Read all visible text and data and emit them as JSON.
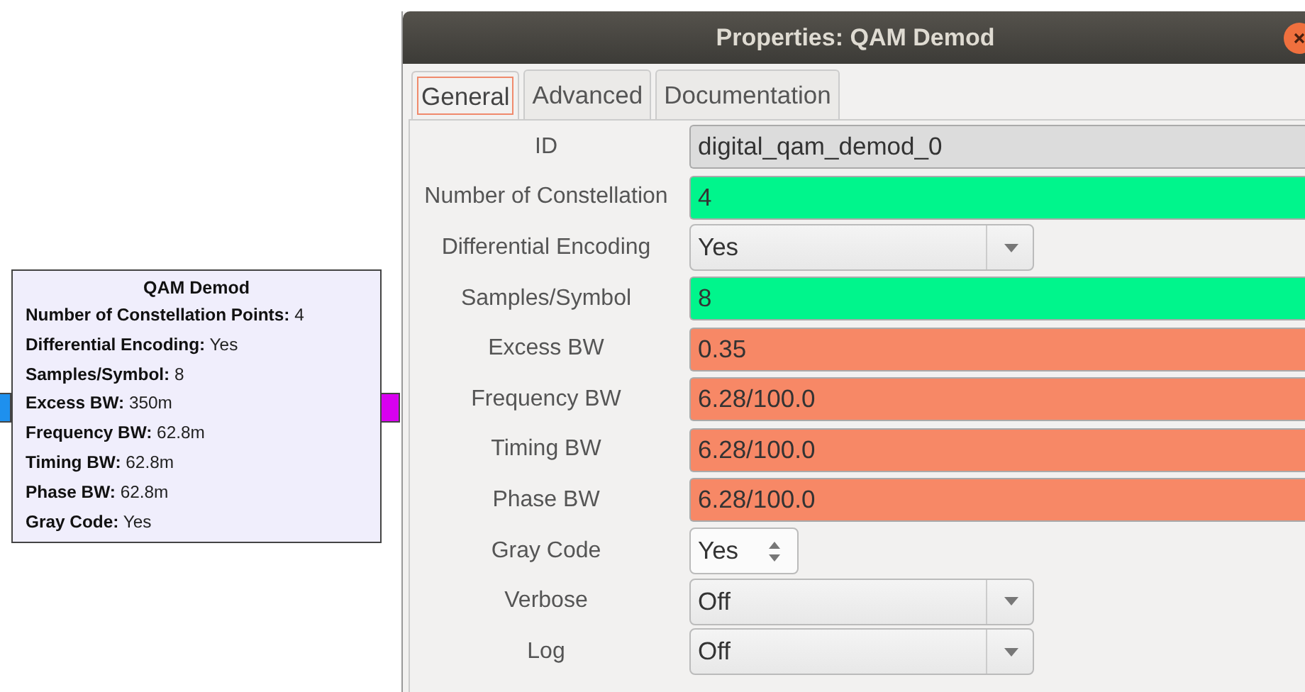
{
  "block": {
    "title": "QAM Demod",
    "params": [
      {
        "name": "Number of Constellation Points:",
        "value": "4"
      },
      {
        "name": "Differential Encoding:",
        "value": "Yes"
      },
      {
        "name": "Samples/Symbol:",
        "value": "8"
      },
      {
        "name": "Excess BW:",
        "value": "350m"
      },
      {
        "name": "Frequency BW:",
        "value": "62.8m"
      },
      {
        "name": "Timing BW:",
        "value": "62.8m"
      },
      {
        "name": "Phase BW:",
        "value": "62.8m"
      },
      {
        "name": "Gray Code:",
        "value": "Yes"
      }
    ]
  },
  "window": {
    "title": "Properties: QAM Demod"
  },
  "tabs": [
    {
      "label": "General",
      "selected": true
    },
    {
      "label": "Advanced",
      "selected": false
    },
    {
      "label": "Documentation",
      "selected": false
    }
  ],
  "fields": [
    {
      "label": "ID",
      "kind": "text",
      "value": "digital_qam_demod_0",
      "color": "#dcdcdc"
    },
    {
      "label": "Number of Constellation",
      "kind": "text",
      "value": "4",
      "color": "#00f58c"
    },
    {
      "label": "Differential Encoding",
      "kind": "combo",
      "value": "Yes"
    },
    {
      "label": "Samples/Symbol",
      "kind": "text",
      "value": "8",
      "color": "#00f58c"
    },
    {
      "label": "Excess BW",
      "kind": "text",
      "value": "0.35",
      "color": "#f78866"
    },
    {
      "label": "Frequency BW",
      "kind": "text",
      "value": "6.28/100.0",
      "color": "#f78866"
    },
    {
      "label": "Timing BW",
      "kind": "text",
      "value": "6.28/100.0",
      "color": "#f78866"
    },
    {
      "label": "Phase BW",
      "kind": "text",
      "value": "6.28/100.0",
      "color": "#f78866"
    },
    {
      "label": "Gray Code",
      "kind": "spin",
      "value": "Yes"
    },
    {
      "label": "Verbose",
      "kind": "combo",
      "value": "Off"
    },
    {
      "label": "Log",
      "kind": "combo",
      "value": "Off"
    }
  ]
}
